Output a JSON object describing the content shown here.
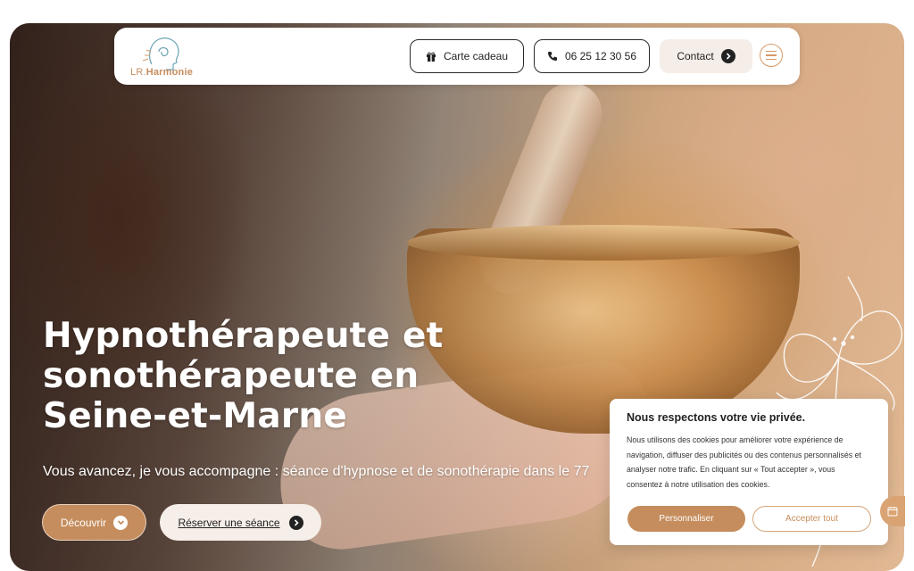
{
  "brand": {
    "logo_prefix": "LR.",
    "logo_name": "Harmonie"
  },
  "header": {
    "gift_label": "Carte cadeau",
    "phone_label": "06 25 12 30 56",
    "contact_label": "Contact"
  },
  "hero": {
    "title": "Hypnothérapeute et sonothérapeute en Seine-et-Marne",
    "subtitle": "Vous avancez, je vous accompagne : séance d'hypnose et de sonothérapie dans le 77",
    "cta_primary": "Découvrir",
    "cta_secondary": "Réserver une séance"
  },
  "cookie": {
    "title": "Nous respectons votre vie privée.",
    "text": "Nous utilisons des cookies pour améliorer votre expérience de navigation, diffuser des publicités ou des contenus personnalisés et analyser notre trafic. En cliquant sur « Tout accepter », vous consentez à notre utilisation des cookies.",
    "customize_label": "Personnaliser",
    "accept_label": "Accepter tout"
  },
  "icons": {
    "gift": "gift-icon",
    "phone": "phone-icon",
    "contact": "arrow-right-circle-icon",
    "menu": "hamburger-icon",
    "discover": "chevron-down-circle-icon",
    "reserve": "arrow-right-circle-icon",
    "calendar": "calendar-icon"
  },
  "colors": {
    "accent": "#c58d5d",
    "accent_light": "#f5ede7",
    "text_dark": "#222222"
  }
}
